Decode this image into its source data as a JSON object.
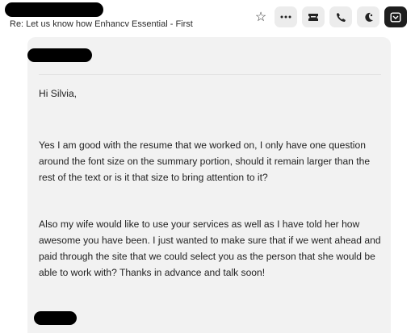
{
  "header": {
    "subject": "Re: Let us know how Enhancv Essential - First"
  },
  "toolbar": {
    "icons": [
      "star-icon",
      "more-icon",
      "ticket-icon",
      "phone-icon",
      "moon-icon",
      "inbox-icon"
    ]
  },
  "message": {
    "greeting": "Hi Silvia,",
    "paragraph1": "Yes I am good with the resume that we worked on, I only have one question around the font size on the summary portion, should it remain larger than the rest of the text or is it that size to bring attention to it?",
    "paragraph2": "Also my wife would like to use your services as well as I have told her how awesome you have been. I just wanted to make sure that if we went ahead and paid through the site that we could select you as the person that she would be able to work with? Thanks in advance and talk soon!"
  }
}
